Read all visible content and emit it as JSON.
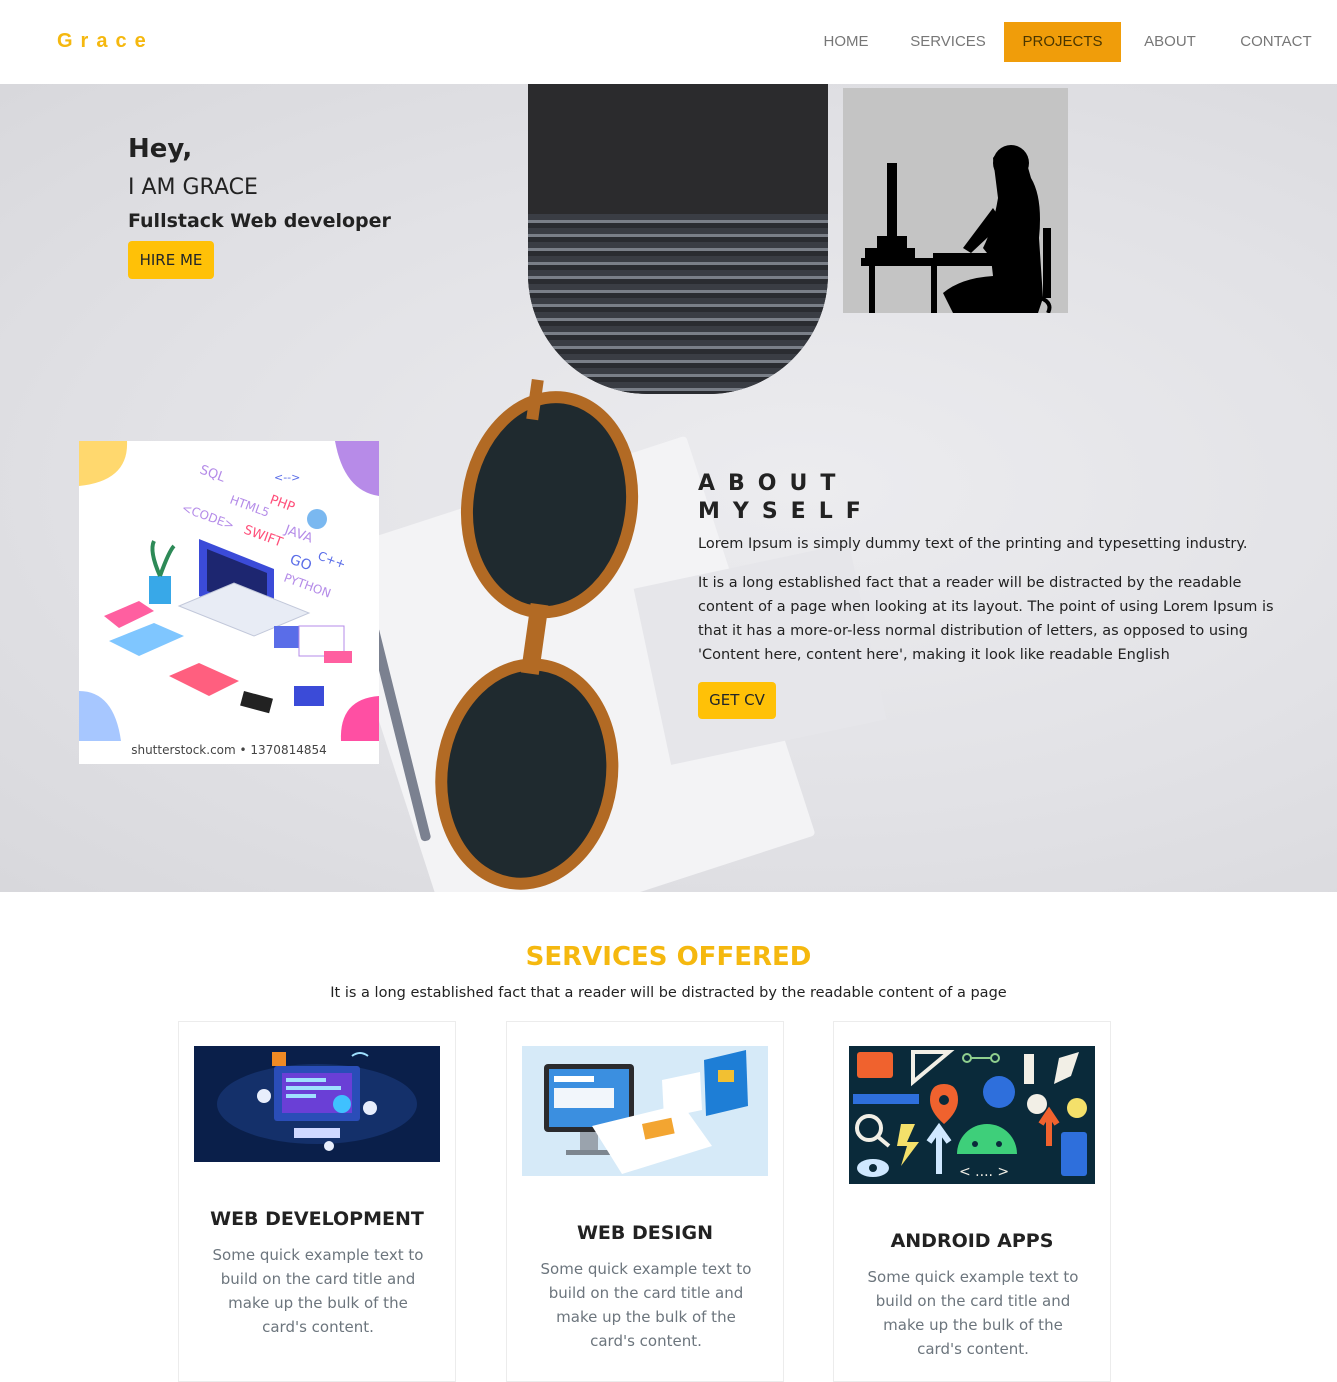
{
  "brand": "Grace",
  "nav": {
    "items": [
      {
        "label": "HOME"
      },
      {
        "label": "SERVICES"
      },
      {
        "label": "PROJECTS",
        "active": true
      },
      {
        "label": "ABOUT"
      },
      {
        "label": "CONTACT"
      }
    ]
  },
  "hero": {
    "greeting": "Hey,",
    "name": "I AM GRACE",
    "role": "Fullstack Web developer",
    "hire_label": "HIRE ME"
  },
  "about": {
    "title_line1": "ABOUT",
    "title_line2": "MYSELF",
    "p1": "Lorem Ipsum is simply dummy text of the printing and typesetting industry.",
    "p2": "It is a long established fact that a reader will be distracted by the readable content of a page when looking at its layout. The point of using Lorem Ipsum is that it has a more-or-less normal distribution of letters, as opposed to using 'Content here, content here', making it look like readable English",
    "cv_label": "GET CV",
    "image_caption": "shutterstock.com • 1370814854",
    "code_words": [
      "SQL",
      "PHP",
      "<-->",
      "HTML5",
      "<CODE>",
      "SWIFT",
      "JAVA",
      "C++",
      "GO",
      "PYTHON"
    ]
  },
  "services": {
    "title": "SERVICES OFFERED",
    "subtitle": "It is a long established fact that a reader will be distracted by the readable content of a page",
    "cards": [
      {
        "title": "WEB DEVELOPMENT",
        "text": "Some quick example text to build on the card title and make up the bulk of the card's content."
      },
      {
        "title": "WEB DESIGN",
        "text": "Some quick example text to build on the card title and make up the bulk of the card's content."
      },
      {
        "title": "ANDROID APPS",
        "text": "Some quick example text to build on the card title and make up the bulk of the card's content."
      }
    ]
  },
  "colors": {
    "accent": "#f5b80f",
    "button_yellow": "#ffc107",
    "nav_active": "#f09d0a"
  }
}
